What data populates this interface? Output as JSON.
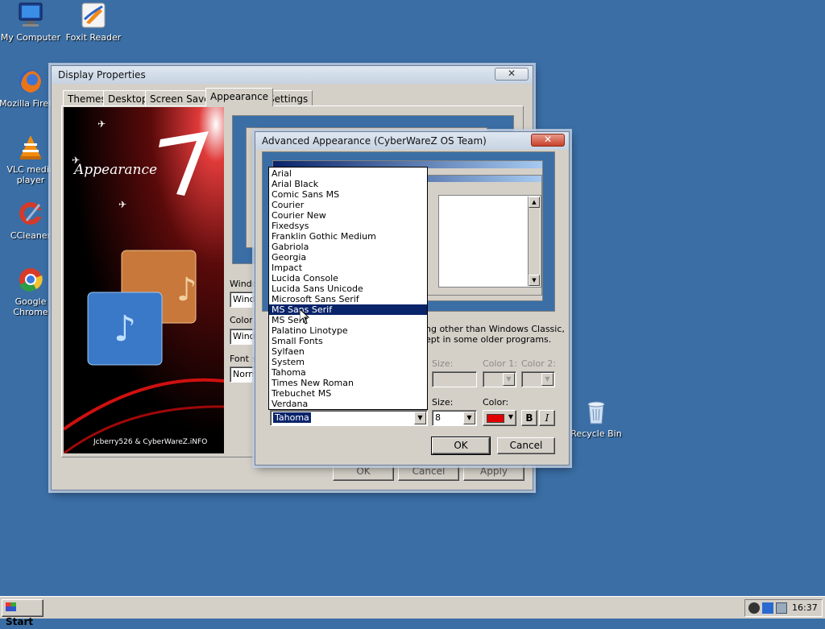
{
  "desktop": {
    "icons": [
      {
        "label": "My Computer",
        "icon": "computer-icon"
      },
      {
        "label": "Foxit Reader",
        "icon": "foxit-icon"
      },
      {
        "label": "Mozilla Firefox",
        "icon": "firefox-icon"
      },
      {
        "label": "VLC media player",
        "icon": "vlc-icon"
      },
      {
        "label": "CCleaner",
        "icon": "ccleaner-icon"
      },
      {
        "label": "Google Chrome",
        "icon": "chrome-icon"
      },
      {
        "label": "Recycle Bin",
        "icon": "recycle-bin-icon"
      }
    ]
  },
  "display_properties": {
    "title": "Display Properties",
    "close": "✕",
    "tabs": [
      "Themes",
      "Desktop",
      "Screen Saver",
      "Appearance",
      "Settings"
    ],
    "active_tab": "Appearance",
    "banner": {
      "title": "Appearance",
      "credit": "Jcberry526 & CyberWareZ.iNFO"
    },
    "windows_label": "Window",
    "windows_value": "Windo",
    "color_label": "Color sc",
    "color_value": "Windo",
    "font_size_label": "Font siz",
    "font_size_value": "Normal",
    "buttons": {
      "ok": "OK",
      "cancel": "Cancel",
      "apply": "Apply"
    }
  },
  "advanced": {
    "title": "Advanced Appearance (CyberWareZ OS Team)",
    "close": "✕",
    "info_line1": "ng other than Windows Classic,",
    "info_line2": "ept in some older programs.",
    "size_label_disabled": "Size:",
    "color1_label": "Color 1:",
    "color2_label": "Color 2:",
    "font_value": "Tahoma",
    "size_label": "Size:",
    "size_value": "8",
    "color_label": "Color:",
    "font_color": "#e00000",
    "bold": "B",
    "italic": "I",
    "ok": "OK",
    "cancel": "Cancel"
  },
  "font_list": {
    "items": [
      "Arial",
      "Arial Black",
      "Comic Sans MS",
      "Courier",
      "Courier New",
      "Fixedsys",
      "Franklin Gothic Medium",
      "Gabriola",
      "Georgia",
      "Impact",
      "Lucida Console",
      "Lucida Sans Unicode",
      "Microsoft Sans Serif",
      "MS Sans Serif",
      "MS Serif",
      "Palatino Linotype",
      "Small Fonts",
      "Sylfaen",
      "System",
      "Tahoma",
      "Times New Roman",
      "Trebuchet MS",
      "Verdana"
    ],
    "selected": "MS Sans Serif"
  },
  "taskbar": {
    "start": "Start",
    "clock": "16:37"
  },
  "colors": {
    "desktop": "#3a6ea5",
    "selection": "#0a246a",
    "face": "#d4d0c8"
  }
}
